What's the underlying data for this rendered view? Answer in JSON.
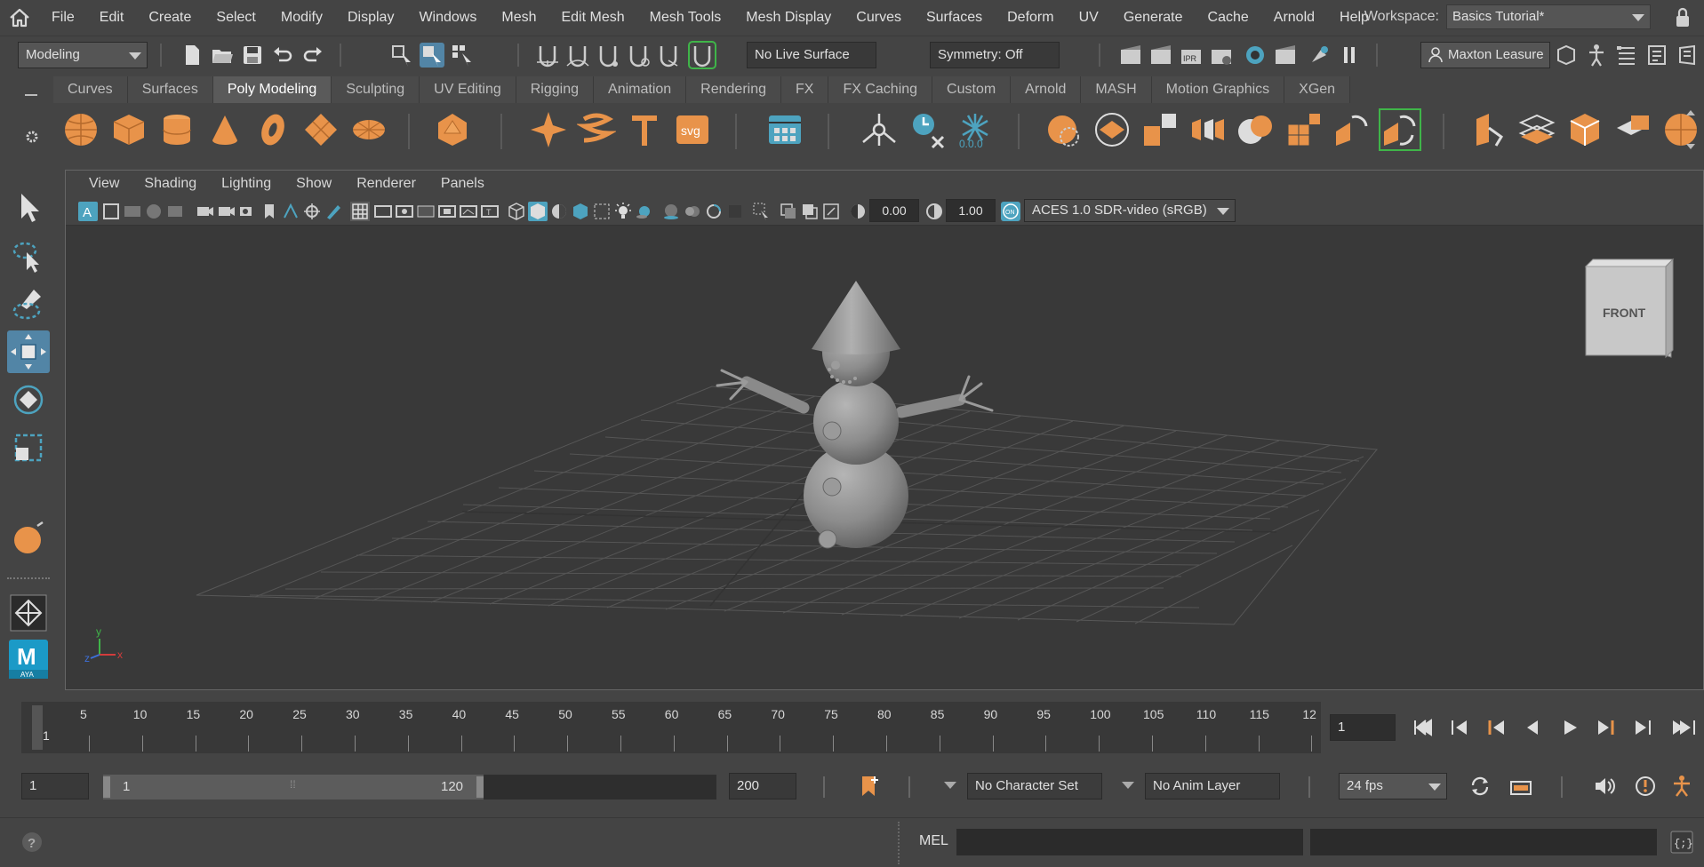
{
  "menubar": {
    "items": [
      "File",
      "Edit",
      "Create",
      "Select",
      "Modify",
      "Display",
      "Windows",
      "Mesh",
      "Edit Mesh",
      "Mesh Tools",
      "Mesh Display",
      "Curves",
      "Surfaces",
      "Deform",
      "UV",
      "Generate",
      "Cache",
      "Arnold",
      "Help"
    ],
    "workspace_label": "Workspace:",
    "workspace_value": "Basics Tutorial*"
  },
  "statusline": {
    "menuset": "Modeling",
    "live_surface": "No Live Surface",
    "symmetry": "Symmetry: Off",
    "user": "Maxton Leasure"
  },
  "shelf": {
    "tabs": [
      "Curves",
      "Surfaces",
      "Poly Modeling",
      "Sculpting",
      "UV Editing",
      "Rigging",
      "Animation",
      "Rendering",
      "FX",
      "FX Caching",
      "Custom",
      "Arnold",
      "MASH",
      "Motion Graphics",
      "XGen"
    ],
    "active_tab": "Poly Modeling",
    "svg_label": "svg",
    "counter_label": "0.0.0"
  },
  "panel": {
    "menus": [
      "View",
      "Shading",
      "Lighting",
      "Show",
      "Renderer",
      "Panels"
    ],
    "exposure": "0.00",
    "gamma": "1.00",
    "colorspace": "ACES 1.0 SDR-video (sRGB)",
    "viewcube_label": "FRONT",
    "axis_x": "x",
    "axis_y": "y",
    "axis_z": "z"
  },
  "timeline": {
    "ticks": [
      "5",
      "10",
      "15",
      "20",
      "25",
      "30",
      "35",
      "40",
      "45",
      "50",
      "55",
      "60",
      "65",
      "70",
      "75",
      "80",
      "85",
      "90",
      "95",
      "100",
      "105",
      "110",
      "115",
      "12"
    ],
    "current_frame_marker": "1",
    "current_frame": "1"
  },
  "range": {
    "start": "1",
    "inner_start": "1",
    "inner_end": "120",
    "end": "200",
    "character_set": "No Character Set",
    "anim_layer": "No Anim Layer",
    "fps": "24 fps"
  },
  "cmdline": {
    "language": "MEL",
    "help_symbol": "?"
  },
  "colors": {
    "accent_blue": "#5285a6",
    "shelf_orange": "#e8934a",
    "bg": "#444444",
    "viewport_bg": "#393939"
  }
}
